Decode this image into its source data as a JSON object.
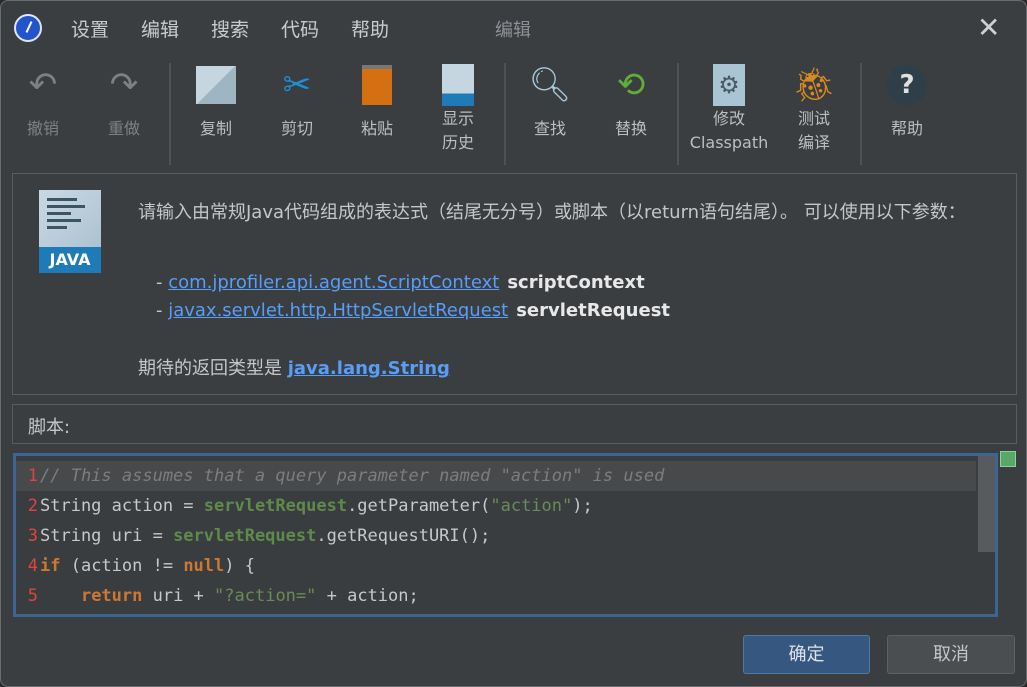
{
  "menubar": {
    "items": [
      "设置",
      "编辑",
      "搜索",
      "代码",
      "帮助"
    ],
    "window_title": "编辑"
  },
  "toolbar": {
    "undo": "撤销",
    "redo": "重做",
    "copy": "复制",
    "cut": "剪切",
    "paste": "粘贴",
    "history_1": "显示",
    "history_2": "历史",
    "find": "查找",
    "replace": "替换",
    "classpath_1": "修改",
    "classpath_2": "Classpath",
    "compile_1": "测试",
    "compile_2": "编译",
    "help": "帮助"
  },
  "info": {
    "java_label": "JAVA",
    "description": "请输入由常规Java代码组成的表达式（结尾无分号）或脚本（以return语句结尾）。 可以使用以下参数：",
    "params": [
      {
        "dash": "- ",
        "type": "com.jprofiler.api.agent.ScriptContext",
        "name": "scriptContext"
      },
      {
        "dash": "- ",
        "type": "javax.servlet.http.HttpServletRequest",
        "name": "servletRequest"
      }
    ],
    "return_prefix": "期待的返回类型是 ",
    "return_type": "java.lang.String"
  },
  "script_label": "脚本:",
  "editor": {
    "lines": [
      {
        "n": "1",
        "comment": "// This assumes that a query parameter named \"action\" is used"
      },
      {
        "n": "2",
        "a": "String action = ",
        "field": "servletRequest",
        "b": ".getParameter(",
        "str": "\"action\"",
        "c": ");"
      },
      {
        "n": "3",
        "a": "String uri = ",
        "field": "servletRequest",
        "b": ".getRequestURI();"
      },
      {
        "n": "4",
        "kw1": "if",
        "a": " (action != ",
        "kw2": "null",
        "b": ") {"
      },
      {
        "n": "5",
        "indent": "    ",
        "kw1": "return",
        "a": " uri + ",
        "str": "\"?action=\"",
        "b": " + action;"
      }
    ]
  },
  "buttons": {
    "ok": "确定",
    "cancel": "取消"
  }
}
